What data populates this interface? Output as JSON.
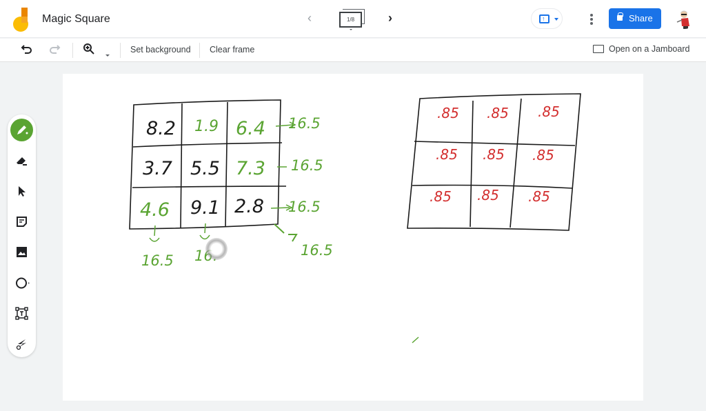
{
  "app": {
    "title": "Magic Square",
    "frame_indicator": "1/8",
    "share_label": "Share"
  },
  "toolbar": {
    "set_background": "Set background",
    "clear_frame": "Clear frame",
    "open_on_jamboard": "Open on a Jamboard"
  },
  "sidebar": {
    "tools": [
      "pen",
      "eraser",
      "select",
      "sticky-note",
      "image",
      "shape",
      "text-box",
      "laser"
    ],
    "active_tool": "pen"
  },
  "board": {
    "left_square": {
      "cells": [
        [
          "8.2",
          "1.9",
          "6.4"
        ],
        [
          "3.7",
          "5.5",
          "7.3"
        ],
        [
          "4.6",
          "9.1",
          "2.8"
        ]
      ],
      "cell_colors": [
        [
          "black",
          "green",
          "green"
        ],
        [
          "black",
          "black",
          "green"
        ],
        [
          "green",
          "black",
          "black"
        ]
      ],
      "row_sums": [
        "16.5",
        "16.5",
        "16.5"
      ],
      "column_sums": [
        "16.5",
        "16."
      ],
      "diagonal_sum": "16.5"
    },
    "right_square": {
      "cells": [
        [
          ".85",
          ".85",
          ".85"
        ],
        [
          ".85",
          ".85",
          ".85"
        ],
        [
          ".85",
          ".85",
          ".85"
        ]
      ]
    },
    "colors": {
      "black_ink": "#1a1a1a",
      "green_ink": "#5aa432",
      "red_ink": "#d32f2f",
      "accent": "#1a73e8"
    }
  }
}
